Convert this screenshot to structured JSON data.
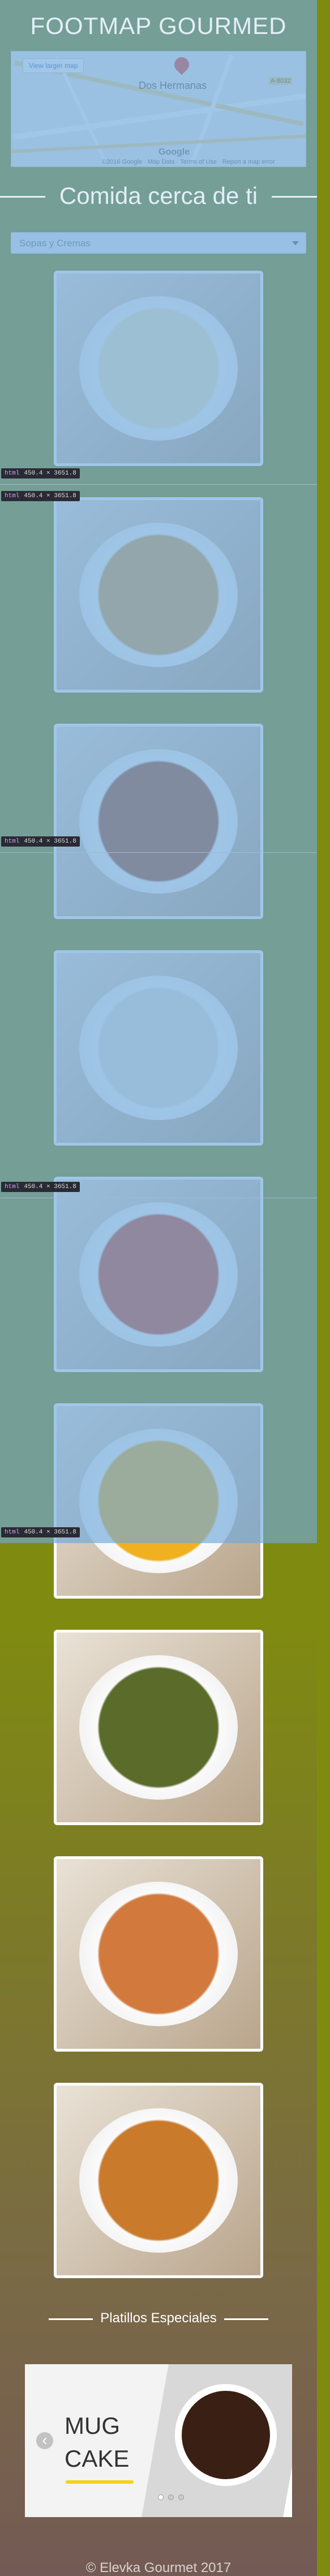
{
  "header": {
    "title": "FOOTMAP GOURMED"
  },
  "map": {
    "view_button": "View larger map",
    "city_label": "Dos Hermanas",
    "road_label": "A-8032",
    "attribution": "©2016 Google · Map Data · Terms of Use · Report a map error",
    "brand": "Google"
  },
  "section1": {
    "heading": "Comida cerca de ti"
  },
  "filter": {
    "selected": "Sopas y Cremas"
  },
  "cards": [
    {
      "name": "sopa-verduras",
      "tone": "#f5e9c2"
    },
    {
      "name": "sopa-marisco",
      "tone": "#d7a24d"
    },
    {
      "name": "caldo-carne",
      "tone": "#a0522d"
    },
    {
      "name": "crema-verde",
      "tone": "#e8e4d8"
    },
    {
      "name": "sopa-tomate",
      "tone": "#cc4a2a"
    },
    {
      "name": "crema-calabaza",
      "tone": "#f0b020"
    },
    {
      "name": "sopa-costilla",
      "tone": "#5a6b2a"
    },
    {
      "name": "sopa-fideos",
      "tone": "#d27a3d"
    },
    {
      "name": "espaguetis-garbanzos",
      "tone": "#c97a2a"
    }
  ],
  "devtools": {
    "label": "html",
    "size": "450.4 × 3651.8"
  },
  "section2": {
    "heading": "Platillos Especiales"
  },
  "slider": {
    "line1": "MUG",
    "line2": "CAKE",
    "prev": "‹"
  },
  "footer": {
    "text": "© Elevka Gourmet 2017"
  }
}
